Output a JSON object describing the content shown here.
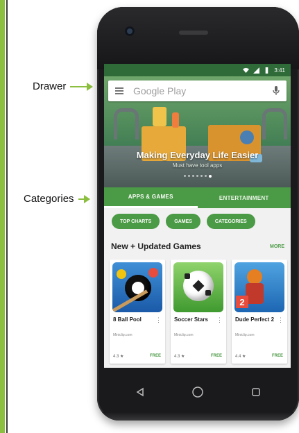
{
  "callouts": {
    "drawer": "Drawer",
    "categories": "Categories"
  },
  "status_bar": {
    "time": "3:41"
  },
  "search": {
    "placeholder": "Google Play"
  },
  "hero": {
    "title": "Making Everyday Life Easier",
    "subtitle": "Must have tool apps"
  },
  "tabs": [
    {
      "label": "APPS & GAMES",
      "active": true
    },
    {
      "label": "ENTERTAINMENT",
      "active": false
    }
  ],
  "chips": [
    "TOP CHARTS",
    "GAMES",
    "CATEGORIES"
  ],
  "section": {
    "title": "New + Updated Games",
    "more": "MORE"
  },
  "apps": [
    {
      "name": "8 Ball Pool",
      "developer": "Miniclip.com",
      "rating": "4.3 ★",
      "price": "FREE"
    },
    {
      "name": "Soccer Stars",
      "developer": "Miniclip.com",
      "rating": "4.3 ★",
      "price": "FREE"
    },
    {
      "name": "Dude Perfect 2",
      "developer": "Miniclip.com",
      "rating": "4.4 ★",
      "price": "FREE"
    }
  ],
  "colors": {
    "accent_green": "#4b9a45",
    "callout_green": "#8cbf3f",
    "status_green": "#2f6b39"
  }
}
